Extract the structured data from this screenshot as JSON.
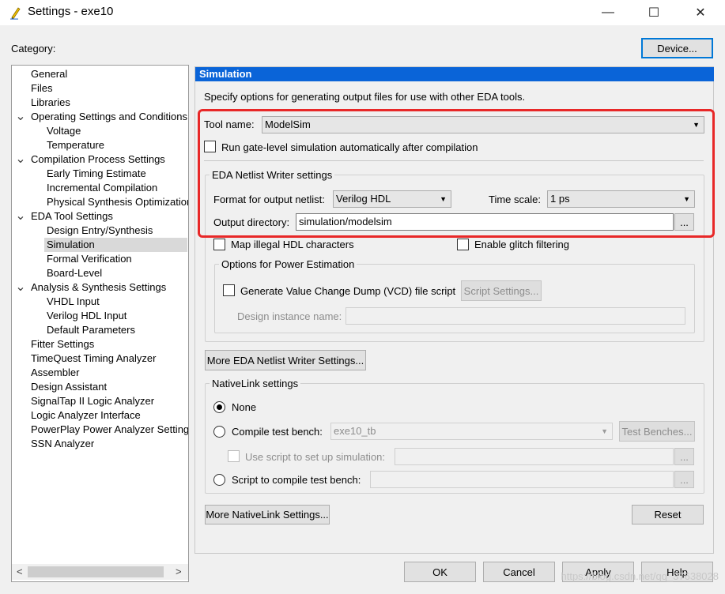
{
  "window": {
    "title": "Settings - exe10",
    "minimize_icon": "—",
    "maximize_icon": "☐",
    "close_icon": "✕"
  },
  "header": {
    "category_label": "Category:",
    "device_button": "Device..."
  },
  "tree": {
    "items": [
      {
        "label": "General",
        "level": 0,
        "expanded": null
      },
      {
        "label": "Files",
        "level": 0,
        "expanded": null
      },
      {
        "label": "Libraries",
        "level": 0,
        "expanded": null
      },
      {
        "label": "Operating Settings and Conditions",
        "level": 0,
        "expanded": true
      },
      {
        "label": "Voltage",
        "level": 1,
        "expanded": null
      },
      {
        "label": "Temperature",
        "level": 1,
        "expanded": null
      },
      {
        "label": "Compilation Process Settings",
        "level": 0,
        "expanded": true
      },
      {
        "label": "Early Timing Estimate",
        "level": 1,
        "expanded": null
      },
      {
        "label": "Incremental Compilation",
        "level": 1,
        "expanded": null
      },
      {
        "label": "Physical Synthesis Optimization",
        "level": 1,
        "expanded": null
      },
      {
        "label": "EDA Tool Settings",
        "level": 0,
        "expanded": true
      },
      {
        "label": "Design Entry/Synthesis",
        "level": 1,
        "expanded": null
      },
      {
        "label": "Simulation",
        "level": 1,
        "expanded": null,
        "selected": true
      },
      {
        "label": "Formal Verification",
        "level": 1,
        "expanded": null
      },
      {
        "label": "Board-Level",
        "level": 1,
        "expanded": null
      },
      {
        "label": "Analysis & Synthesis Settings",
        "level": 0,
        "expanded": true
      },
      {
        "label": "VHDL Input",
        "level": 1,
        "expanded": null
      },
      {
        "label": "Verilog HDL Input",
        "level": 1,
        "expanded": null
      },
      {
        "label": "Default Parameters",
        "level": 1,
        "expanded": null
      },
      {
        "label": "Fitter Settings",
        "level": 0,
        "expanded": null
      },
      {
        "label": "TimeQuest Timing Analyzer",
        "level": 0,
        "expanded": null
      },
      {
        "label": "Assembler",
        "level": 0,
        "expanded": null
      },
      {
        "label": "Design Assistant",
        "level": 0,
        "expanded": null
      },
      {
        "label": "SignalTap II Logic Analyzer",
        "level": 0,
        "expanded": null
      },
      {
        "label": "Logic Analyzer Interface",
        "level": 0,
        "expanded": null
      },
      {
        "label": "PowerPlay Power Analyzer Settings",
        "level": 0,
        "expanded": null
      },
      {
        "label": "SSN Analyzer",
        "level": 0,
        "expanded": null
      }
    ],
    "scroll_left": "<",
    "scroll_right": ">"
  },
  "panel": {
    "title": "Simulation",
    "description": "Specify options for generating output files for use with other EDA tools.",
    "tool_name_label": "Tool name:",
    "tool_name_value": "ModelSim",
    "run_gate_level_label": "Run gate-level simulation automatically after compilation",
    "netlist_group_label": "EDA Netlist Writer settings",
    "format_label": "Format for output netlist:",
    "format_value": "Verilog HDL",
    "time_scale_label": "Time scale:",
    "time_scale_value": "1 ps",
    "output_dir_label": "Output directory:",
    "output_dir_value": "simulation/modelsim",
    "browse_label": "...",
    "map_illegal_label": "Map illegal HDL characters",
    "glitch_label": "Enable glitch filtering",
    "power_group_label": "Options for Power Estimation",
    "vcd_label": "Generate Value Change Dump (VCD) file script",
    "script_settings_button": "Script Settings...",
    "design_instance_label": "Design instance name:",
    "more_netlist_button": "More EDA Netlist Writer Settings...",
    "nativelink_group_label": "NativeLink settings",
    "none_label": "None",
    "compile_tb_label": "Compile test bench:",
    "compile_tb_value": "exe10_tb",
    "test_benches_button": "Test Benches...",
    "use_script_label": "Use script to set up simulation:",
    "script_compile_label": "Script to compile test bench:",
    "more_nativelink_button": "More NativeLink Settings...",
    "reset_button": "Reset"
  },
  "footer": {
    "ok": "OK",
    "cancel": "Cancel",
    "apply": "Apply",
    "help": "Help"
  },
  "watermark": "https://blog.csdn.net/qq_37638028"
}
